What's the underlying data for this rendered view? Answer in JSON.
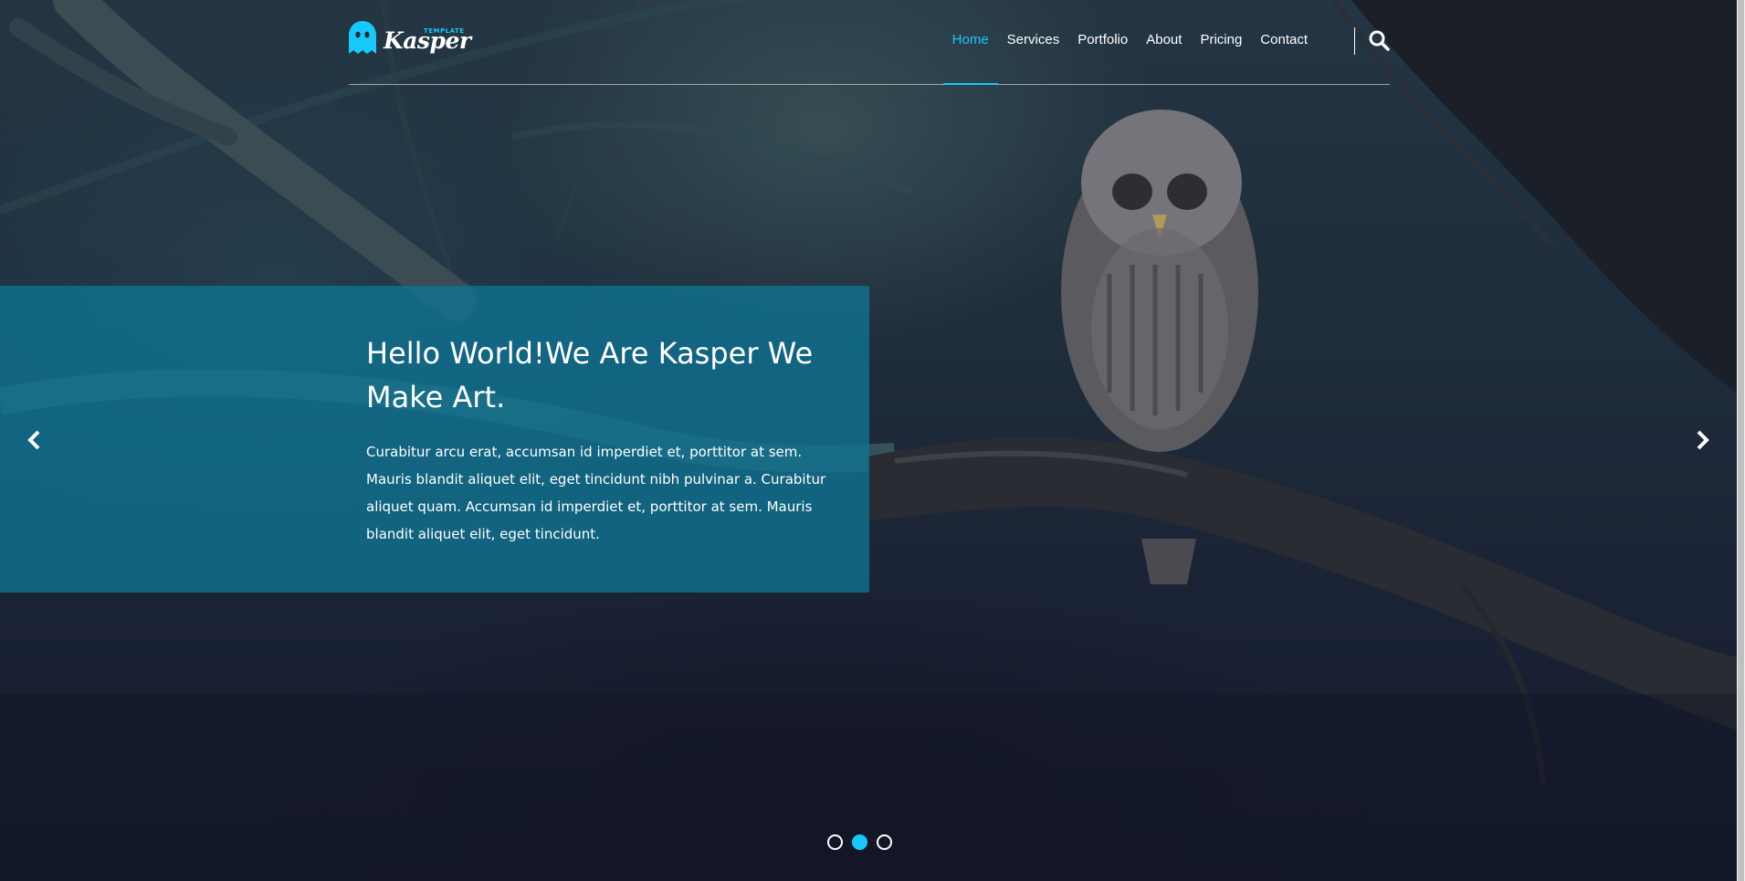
{
  "brand": {
    "name": "Kasper",
    "tagline": "TEMPLATE",
    "accent_color": "#19c8fa",
    "logo_icon": "ghost-icon"
  },
  "nav": {
    "items": [
      {
        "label": "Home",
        "active": true
      },
      {
        "label": "Services",
        "active": false
      },
      {
        "label": "Portfolio",
        "active": false
      },
      {
        "label": "About",
        "active": false
      },
      {
        "label": "Pricing",
        "active": false
      },
      {
        "label": "Contact",
        "active": false
      }
    ],
    "search_icon": "search-icon"
  },
  "slide": {
    "title": "Hello World!We Are Kasper We Make Art.",
    "text": "Curabitur arcu erat, accumsan id imperdiet et, porttitor at sem. Mauris blandit aliquet elit, eget tincidunt nibh pulvinar a. Curabitur aliquet quam. Accumsan id imperdiet et, porttitor at sem. Mauris blandit aliquet elit, eget tincidunt.",
    "box_color": "#0f7494",
    "prev_icon": "chevron-left-icon",
    "next_icon": "chevron-right-icon"
  },
  "slider": {
    "slide_count": 3,
    "active_index": 1
  }
}
